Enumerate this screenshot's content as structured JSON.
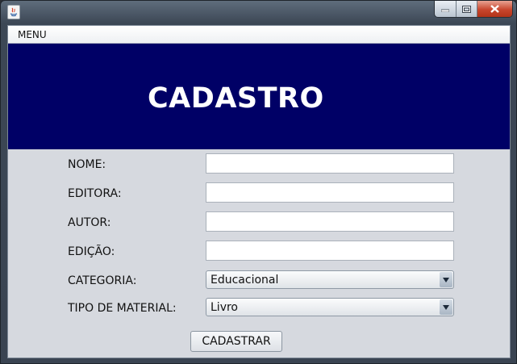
{
  "window": {
    "title": ""
  },
  "menu": {
    "items": [
      "MENU"
    ]
  },
  "banner": {
    "title": "CADASTRO"
  },
  "form": {
    "fields": [
      {
        "label": "NOME:",
        "value": ""
      },
      {
        "label": "EDITORA:",
        "value": ""
      },
      {
        "label": "AUTOR:",
        "value": ""
      },
      {
        "label": "EDIÇÃO:",
        "value": ""
      }
    ],
    "categoria": {
      "label": "CATEGORIA:",
      "selected": "Educacional"
    },
    "tipo_material": {
      "label": "TIPO DE MATERIAL:",
      "selected": "Livro"
    },
    "submit_label": "CADASTRAR"
  },
  "colors": {
    "banner_bg": "#000066",
    "form_bg": "#d6d9df",
    "close_button": "#c8462d"
  },
  "icons": [
    "java-app-icon",
    "minimize-icon",
    "maximize-icon",
    "close-icon",
    "dropdown-arrow-icon"
  ]
}
